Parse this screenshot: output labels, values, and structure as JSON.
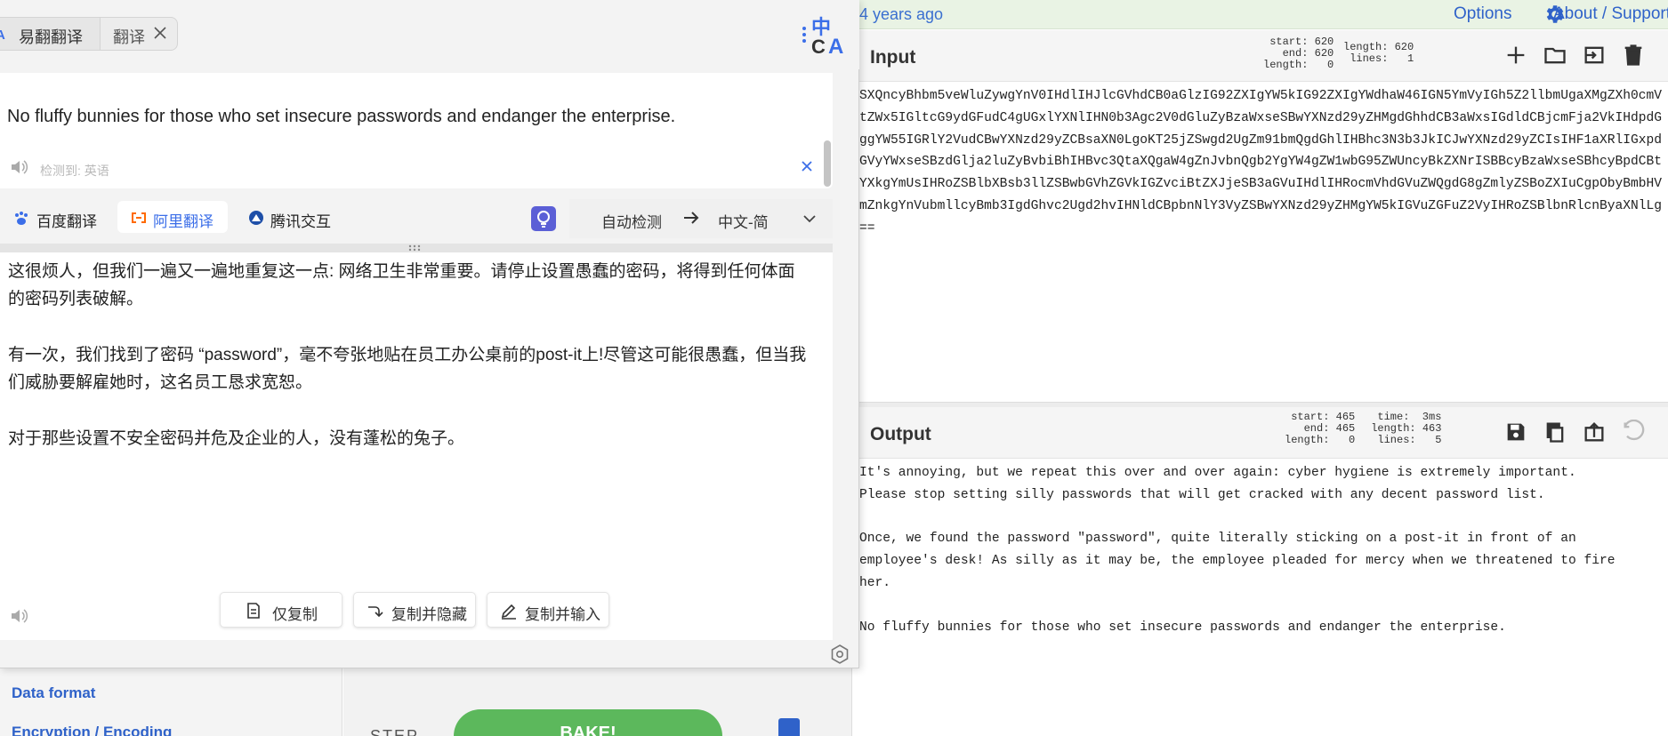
{
  "cyberchef": {
    "last_build": "4 years ago",
    "options_label": "Options",
    "about_label": "About / Support",
    "input": {
      "title": "Input",
      "stats_left": "start: 620\n  end: 620\nlength:   0",
      "stats_right": "length: 620\n lines:   1",
      "lines": [
        "SXQncyBhbm5veWluZywgYnV0IHdlIHJlcGVhdCB0aGlzIG92ZXIgYW5kIG92ZXIgYWdhaW46IGN5YmVyIGh5Z2llbmUgaXMgZXh0cmVtZWx5IGltcG9ydGFudC4gUGxlYXNlIHN0b3Agc2V0dGluZyBzaWxseSBwYXNzd29yZHMgdGhhdCB3aWxsIGdldCBjcmFja2VkIHdpdGggYW55IGRlY2VudCBwYXNzd29yZCBsaXN0LgoKT25jZSwgd2UgZm91bmQgdGhlIHBhc3N3b3JkICJwYXNzd29yZCIsIHF1aXRlIGxpdGVyYWxseSBzdGlja2luZyBvbiBhIHBvc3QtaXQgaW4gZnJvbnQgb2YgYW4gZW1wbG95ZWUncyBkZXNrISBBcyBzaWxseSBhcyBpdCBtYXkgYmUsIHRoZSBlbXBsb3llZSBwbGVhZGVkIGZvciBtZXJjeSB3aGVuIHdlIHRocmVhdGVuZWQgdG8gZmlyZSBoZXIuCgpObyBmbHVmZnkgYnVubmllcyBmb3IgdGhvc2Ugd2hvIHNldCBpbnNlY3VyZSBwYXNzd29yZHMgYW5kIGVuZGFuZ2VyIHRoZSBlbnRlcnByaXNlLg=="
      ]
    },
    "output": {
      "title": "Output",
      "stats_left": "start: 465\n  end: 465\nlength:   0",
      "stats_right": "  time:  3ms\nlength: 463\n lines:   5",
      "text": "It's annoying, but we repeat this over and over again: cyber hygiene is extremely important.\nPlease stop setting silly passwords that will get cracked with any decent password list.\n\nOnce, we found the password \"password\", quite literally sticking on a post-it in front of an\nemployee's desk! As silly as it may be, the employee pleaded for mercy when we threatened to fire\nher.\n\nNo fluffy bunnies for those who set insecure passwords and endanger the enterprise."
    },
    "sidebar": {
      "data_format": "Data format",
      "encoding": "Encryption / Encoding"
    },
    "recipe": {
      "step_label": "STEP",
      "bake_label": "BAKE!"
    },
    "colors": {
      "accent": "#2f62c9",
      "bake": "#5cb85c",
      "topbar": "#e9f3e4"
    }
  },
  "translator": {
    "tab_app": "易翻翻译",
    "tab_translate": "翻译",
    "source_text": "No fluffy bunnies for those who set insecure passwords and endanger the enterprise.",
    "detected_label": "检测到: 英语",
    "engines": [
      {
        "name": "百度翻译",
        "icon": "paw-icon"
      },
      {
        "name": "阿里翻译",
        "icon": "ali-bracket-icon",
        "active": true
      },
      {
        "name": "腾讯交互",
        "icon": "tencent-icon"
      }
    ],
    "source_lang": "自动检测",
    "target_lang": "中文-简",
    "result_paragraphs": [
      "这很烦人，但我们一遍又一遍地重复这一点: 网络卫生非常重要。请停止设置愚蠢的密码，将得到任何体面的密码列表破解。",
      "有一次，我们找到了密码 “password”，毫不夸张地贴在员工办公桌前的post-it上!尽管这可能很愚蠢，但当我们威胁要解雇她时，这名员工恳求宽恕。",
      "对于那些设置不安全密码并危及企业的人，没有蓬松的兔子。"
    ],
    "buttons": {
      "copy_only": "仅复制",
      "copy_hide": "复制并隐藏",
      "copy_input": "复制并输入"
    },
    "colors": {
      "active_engine": "#3b6ee8",
      "bulb": "#5b5fd6"
    }
  }
}
